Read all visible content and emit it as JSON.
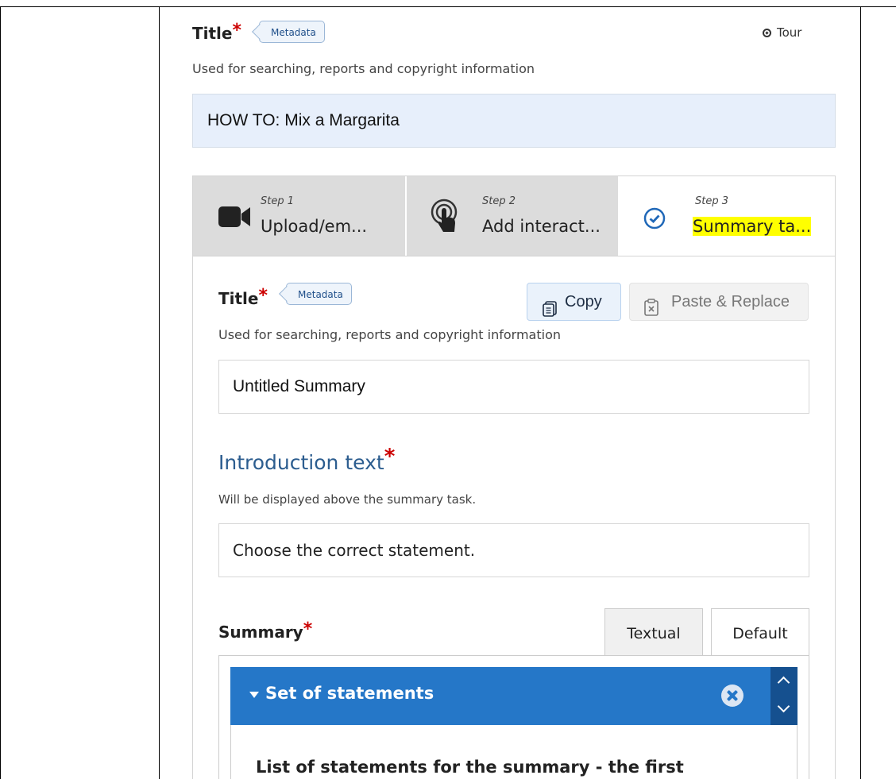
{
  "main_title": {
    "label": "Title",
    "required": "*",
    "tag": "Metadata",
    "description": "Used for searching, reports and copyright information",
    "value": "HOW TO: Mix a Margarita"
  },
  "tour": {
    "label": "Tour",
    "icon": "compass-icon"
  },
  "steps": [
    {
      "small": "Step 1",
      "label": "Upload/em...",
      "icon": "video-camera-icon"
    },
    {
      "small": "Step 2",
      "label": "Add interact...",
      "icon": "touch-hand-icon"
    },
    {
      "small": "Step 3",
      "label": "Summary ta...",
      "icon": "check-circle-icon",
      "active": true,
      "highlight": "#ffff00"
    }
  ],
  "summary_title": {
    "label": "Title",
    "required": "*",
    "tag": "Metadata",
    "description": "Used for searching, reports and copyright information",
    "value": "Untitled Summary"
  },
  "buttons": {
    "copy": "Copy",
    "paste_replace": "Paste & Replace"
  },
  "introduction": {
    "heading": "Introduction text",
    "required": "*",
    "description": "Will be displayed above the summary task.",
    "value": "Choose the correct statement."
  },
  "summary": {
    "label": "Summary",
    "required": "*",
    "tabs": [
      "Textual",
      "Default"
    ],
    "active_tab": "Default",
    "group": {
      "label": "Set of statements",
      "text": "List of statements for the summary - the first"
    }
  },
  "colors": {
    "accent": "#2577c8",
    "required": "#cc0000",
    "heading": "#2c5d8f"
  }
}
